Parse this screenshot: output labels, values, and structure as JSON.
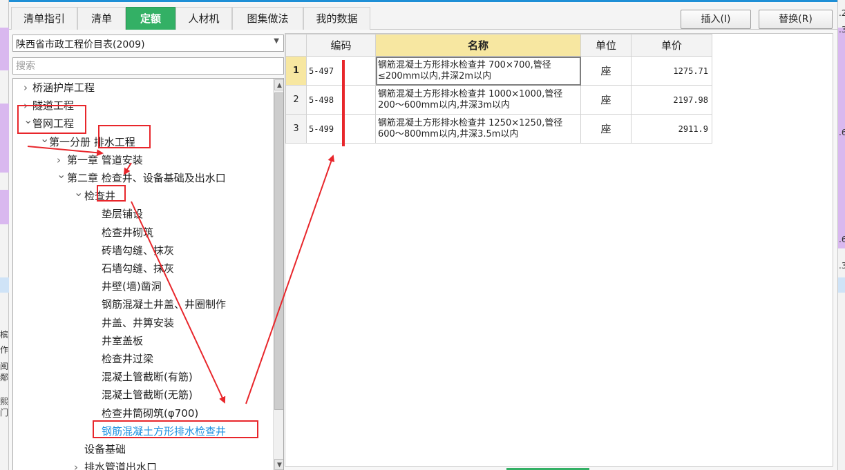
{
  "tabs": [
    {
      "label": "清单指引",
      "active": false
    },
    {
      "label": "清单",
      "active": false
    },
    {
      "label": "定额",
      "active": true
    },
    {
      "label": "人材机",
      "active": false
    },
    {
      "label": "图集做法",
      "active": false
    },
    {
      "label": "我的数据",
      "active": false
    }
  ],
  "buttons": {
    "insert": "插入(I)",
    "replace": "替换(R)"
  },
  "library": {
    "selected": "陕西省市政工程价目表(2009)"
  },
  "search": {
    "placeholder": "搜索"
  },
  "tree": [
    {
      "label": "桥涵护岸工程",
      "expander": "collapsed"
    },
    {
      "label": "隧道工程",
      "expander": "collapsed"
    },
    {
      "label": "管网工程",
      "expander": "expanded"
    },
    {
      "label": "第一分册  排水工程",
      "expander": "expanded"
    },
    {
      "label": "第一章  管道安装",
      "expander": "collapsed"
    },
    {
      "label": "第二章  检查井、设备基础及出水口",
      "expander": "expanded"
    },
    {
      "label": "检查井",
      "expander": "expanded"
    },
    {
      "label": "垫层铺设",
      "expander": "none"
    },
    {
      "label": "检查井砌筑",
      "expander": "none"
    },
    {
      "label": "砖墙勾缝、抹灰",
      "expander": "none"
    },
    {
      "label": "石墙勾缝、抹灰",
      "expander": "none"
    },
    {
      "label": "井壁(墙)凿洞",
      "expander": "none"
    },
    {
      "label": "钢筋混凝土井盖、井圈制作",
      "expander": "none"
    },
    {
      "label": "井盖、井箅安装",
      "expander": "none"
    },
    {
      "label": "井室盖板",
      "expander": "none"
    },
    {
      "label": "检查井过梁",
      "expander": "none"
    },
    {
      "label": "混凝土管截断(有筋)",
      "expander": "none"
    },
    {
      "label": "混凝土管截断(无筋)",
      "expander": "none"
    },
    {
      "label": "检查井筒砌筑(φ700)",
      "expander": "none"
    },
    {
      "label": "钢筋混凝土方形排水检查井",
      "expander": "none",
      "selected": true
    },
    {
      "label": "设备基础",
      "expander": "none"
    },
    {
      "label": "排水管道出水口",
      "expander": "collapsed"
    }
  ],
  "grid": {
    "columns": [
      "编码",
      "名称",
      "单位",
      "单价"
    ],
    "rows": [
      {
        "index": "1",
        "code": "5-497",
        "name": "钢筋混凝土方形排水检查井  700×700,管径≤200mm以内,井深2m以内",
        "unit": "座",
        "price": "1275.71"
      },
      {
        "index": "2",
        "code": "5-498",
        "name": "钢筋混凝土方形排水检查井  1000×1000,管径200～600mm以内,井深3m以内",
        "unit": "座",
        "price": "2197.98"
      },
      {
        "index": "3",
        "code": "5-499",
        "name": "钢筋混凝土方形排水检查井  1250×1250,管径600～800mm以内,井深3.5m以内",
        "unit": "座",
        "price": "2911.9"
      }
    ]
  },
  "background_fragments": {
    "left": [
      "作",
      "闽",
      "鄰",
      "熙",
      "门",
      "槟"
    ],
    "right": [
      ".2",
      ".3",
      ".6",
      ".6",
      ".3"
    ]
  },
  "colors": {
    "accent_green": "#33b065",
    "header_yellow": "#f7e7a1",
    "annotation_red": "#e8262b",
    "selected_blue": "#1a8fe0",
    "title_blue": "#1e8fd6"
  }
}
